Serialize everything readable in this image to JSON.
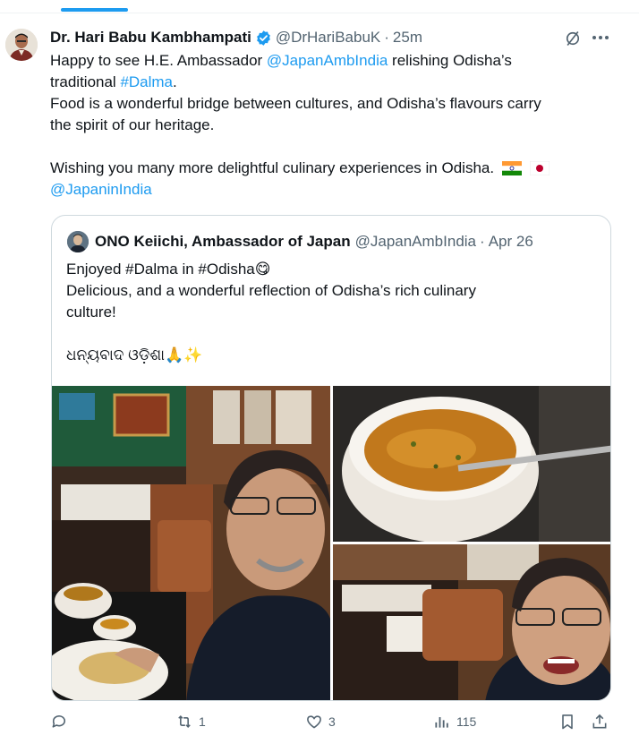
{
  "tweet": {
    "author_name": "Dr. Hari Babu Kambhampati",
    "handle": "@DrHariBabuK",
    "separator": "·",
    "time": "25m",
    "lines": [
      {
        "pre": "Happy to see H.E. Ambassador ",
        "mention": "@JapanAmbIndia",
        "post": " relishing Odisha’s"
      },
      {
        "pre": "traditional ",
        "hashtag": "#Dalma",
        "post": "."
      },
      {
        "text": "Food is a wonderful bridge between cultures, and Odisha’s flavours carry"
      },
      {
        "text": "the spirit of our heritage."
      },
      {
        "text": "Wishing you many more delightful culinary experiences in Odisha."
      },
      {
        "mention": "@JapaninIndia"
      }
    ]
  },
  "quote": {
    "author_name": "ONO Keiichi, Ambassador of Japan",
    "handle": "@JapanAmbIndia",
    "separator": "·",
    "date": "Apr 26",
    "lines": [
      "Enjoyed #Dalma in #Odisha😋",
      "Delicious, and a wonderful reflection of Odisha’s rich culinary",
      "culture!",
      "ଧନ୍ୟବାଦ ଓଡ଼ିଶା🙏✨"
    ]
  },
  "actions": {
    "replies": "",
    "reposts": "1",
    "likes": "3",
    "views": "115"
  },
  "colors": {
    "accent": "#1d9bf0",
    "secondary_text": "#536471",
    "border": "#cfd9de"
  },
  "icons": [
    "verified-badge-icon",
    "grok-icon",
    "more-icon",
    "reply-icon",
    "repost-icon",
    "like-icon",
    "views-icon",
    "bookmark-icon",
    "share-icon"
  ]
}
